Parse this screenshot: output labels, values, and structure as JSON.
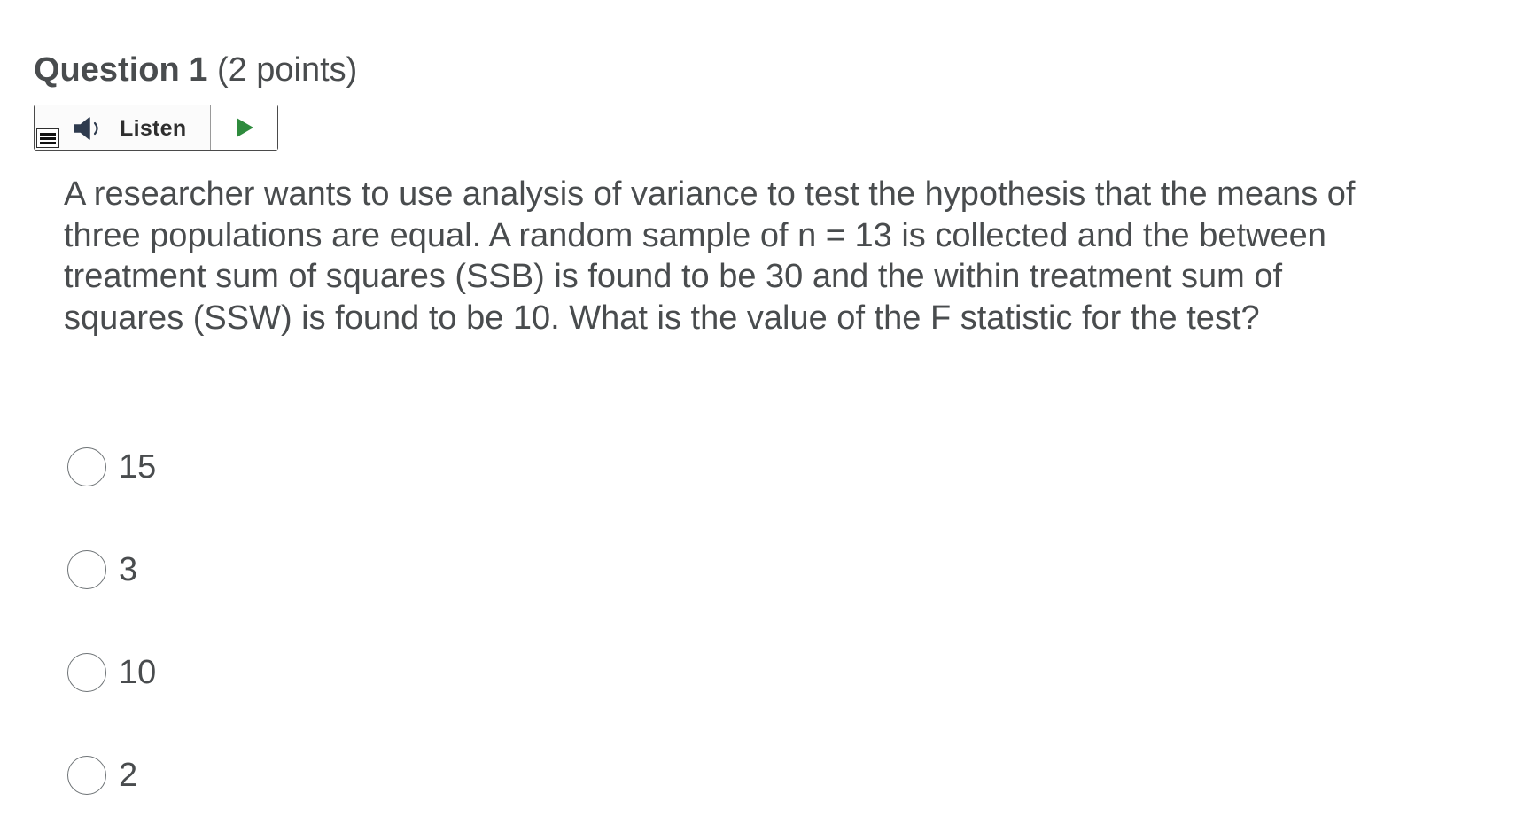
{
  "question": {
    "title": "Question 1",
    "points": "(2 points)",
    "text": "A researcher wants to use analysis of variance to test the hypothesis that the means of three populations are equal. A random sample of n = 13 is collected and the between treatment sum of squares (SSB) is found to be 30 and the within treatment sum of squares (SSW) is found to be 10. What is the value of the F statistic for the test?"
  },
  "listen": {
    "label": "Listen",
    "icons": [
      "menu-icon",
      "speaker-icon",
      "play-icon"
    ],
    "play_color": "#2e8b3d"
  },
  "options": [
    {
      "label": "15",
      "selected": false
    },
    {
      "label": "3",
      "selected": false
    },
    {
      "label": "10",
      "selected": false
    },
    {
      "label": "2",
      "selected": false
    }
  ]
}
